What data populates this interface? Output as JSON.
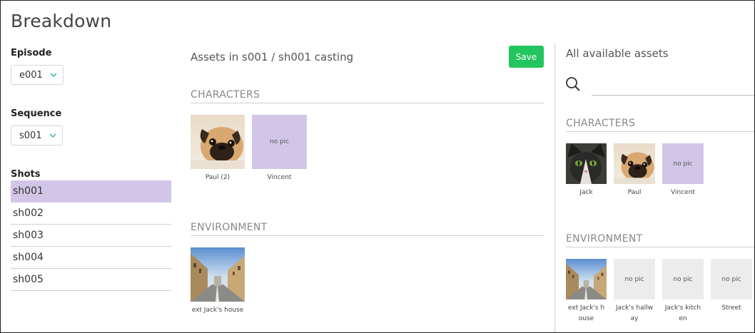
{
  "page": {
    "title": "Breakdown"
  },
  "filters": {
    "episode": {
      "label": "Episode",
      "value": "e001"
    },
    "sequence": {
      "label": "Sequence",
      "value": "s001"
    },
    "shots_label": "Shots",
    "shots": [
      "sh001",
      "sh002",
      "sh003",
      "sh004",
      "sh005"
    ]
  },
  "casting": {
    "title": "Assets in s001 / sh001 casting",
    "save_label": "Save",
    "characters_heading": "CHARACTERS",
    "characters": [
      {
        "label": "Paul (2)",
        "thumb": "pug",
        "nopic": ""
      },
      {
        "label": "Vincent",
        "thumb": "",
        "nopic": "no pic"
      }
    ],
    "environment_heading": "ENVIRONMENT",
    "environment": [
      {
        "label": "ext Jack's house",
        "thumb": "street-photo",
        "nopic": ""
      }
    ]
  },
  "available": {
    "title": "All available assets",
    "search": {
      "value": "",
      "placeholder": ""
    },
    "characters_heading": "CHARACTERS",
    "characters": [
      {
        "label": "Jack",
        "thumb": "cat",
        "nopic": ""
      },
      {
        "label": "Paul",
        "thumb": "pug",
        "nopic": ""
      },
      {
        "label": "Vincent",
        "thumb": "",
        "nopic": "no pic"
      }
    ],
    "environment_heading": "ENVIRONMENT",
    "environment": [
      {
        "label_l1": "ext Jack's h",
        "label_l2": "ouse",
        "thumb": "street-photo",
        "nopic": ""
      },
      {
        "label_l1": "Jack's hallw",
        "label_l2": "ay",
        "thumb": "",
        "nopic": "no pic"
      },
      {
        "label_l1": "Jack's kitch",
        "label_l2": "en",
        "thumb": "",
        "nopic": "no pic"
      },
      {
        "label_l1": "Street",
        "label_l2": "",
        "thumb": "",
        "nopic": "no pic"
      }
    ]
  },
  "colors": {
    "selected_row": "#d2c6e8",
    "save_button": "#22c55e",
    "nopic_purple": "#d2c6e8",
    "nopic_grey": "#ececec",
    "chevron": "#20b2aa"
  }
}
